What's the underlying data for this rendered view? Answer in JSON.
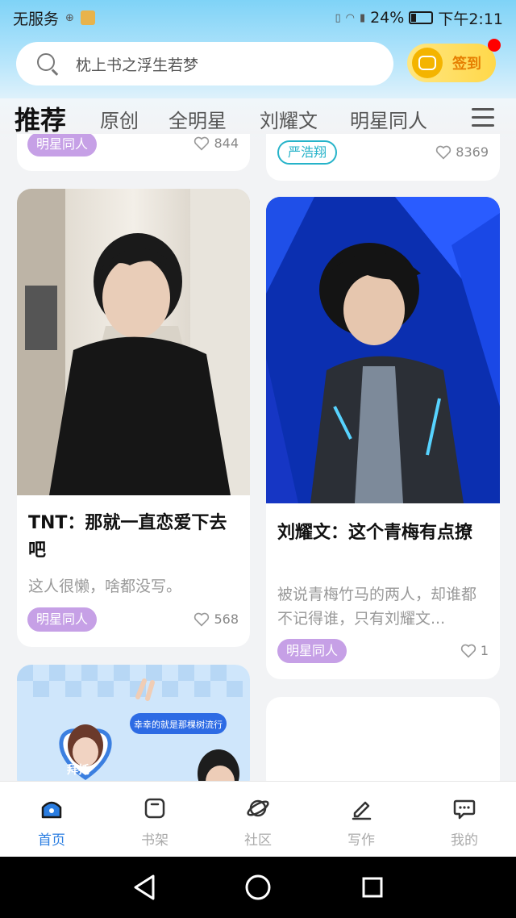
{
  "status_bar": {
    "carrier": "无服务",
    "battery": "24%",
    "time": "下午2:11"
  },
  "search": {
    "placeholder": "枕上书之浮生若梦"
  },
  "checkin": {
    "label": "签到"
  },
  "tabs": [
    {
      "label": "推荐",
      "active": true
    },
    {
      "label": "原创"
    },
    {
      "label": "全明星"
    },
    {
      "label": "刘耀文"
    },
    {
      "label": "明星同人"
    }
  ],
  "feed": {
    "top_left": {
      "tag": "明星同人",
      "likes": "844"
    },
    "top_right": {
      "tag": "严浩翔",
      "likes": "8369"
    },
    "card_left": {
      "title": "TNT：那就一直恋爱下去吧",
      "desc": "这人很懒，啥都没写。",
      "tag": "明星同人",
      "likes": "568"
    },
    "card_right": {
      "title": "刘耀文：这个青梅有点撩",
      "desc": "被说青梅竹马的两人，却谁都不记得谁，只有刘耀文...",
      "tag": "明星同人",
      "likes": "1"
    },
    "bottom_left": {
      "banner_text": "拜托",
      "banner_caption": "幸幸的就是那棵树流行"
    }
  },
  "bottom_nav": [
    {
      "label": "首页",
      "icon": "home-icon",
      "active": true
    },
    {
      "label": "书架",
      "icon": "bookshelf-icon"
    },
    {
      "label": "社区",
      "icon": "planet-icon"
    },
    {
      "label": "写作",
      "icon": "pen-icon"
    },
    {
      "label": "我的",
      "icon": "chat-bubble-icon"
    }
  ],
  "colors": {
    "accent": "#2a7de1",
    "tag_purple": "#c6a0e6",
    "tag_teal": "#26b3c9",
    "checkin_yellow": "#ffd84a",
    "notification_red": "#ff0000"
  }
}
